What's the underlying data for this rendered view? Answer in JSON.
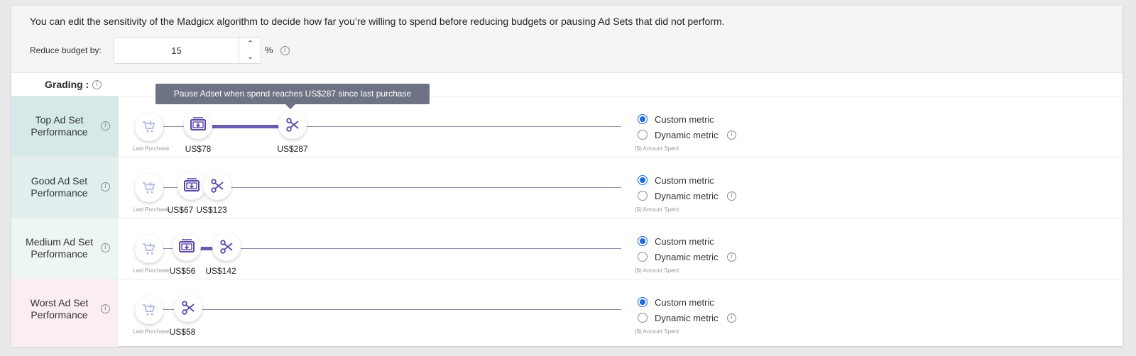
{
  "description": "You can edit the sensitivity of the Madgicx algorithm to decide how far you’re willing to spend before reducing budgets or pausing Ad Sets that did not perform.",
  "reduce_budget": {
    "label": "Reduce budget by:",
    "value": "15",
    "unit": "%",
    "up": "⌃",
    "down": "⌄"
  },
  "grading_label": "Grading :",
  "info_glyph": "i",
  "tooltip": "Pause Adset when spend reaches US$287 since last purchase",
  "last_purchase_caption": "Last Purchase",
  "amount_spent_caption": "($) Amount Spent",
  "radio_options": {
    "custom": "Custom metric",
    "dynamic": "Dynamic metric"
  },
  "rows": [
    {
      "label": "Top Ad Set Performance",
      "budget": "US$78",
      "pause": "US$287",
      "custom_selected": true
    },
    {
      "label": "Good Ad Set Performance",
      "budget": "US$67",
      "pause": "US$123",
      "custom_selected": true
    },
    {
      "label": "Medium Ad Set Performance",
      "budget": "US$56",
      "pause": "US$142",
      "custom_selected": true
    },
    {
      "label": "Worst Ad Set Performance",
      "budget": "",
      "pause": "US$58",
      "custom_selected": true
    }
  ],
  "colors": {
    "accent": "#6d5bb0",
    "radio_selected": "#1f6ddb",
    "tooltip_bg": "#6d7384",
    "row_top": "#d7e8e8",
    "row_good": "#e2efef",
    "row_medium": "#eef5f5",
    "row_worst": "#fbeef0"
  },
  "icons": {
    "last_purchase": "cart-icon",
    "budget": "money-down-icon",
    "pause": "scissors-icon"
  }
}
